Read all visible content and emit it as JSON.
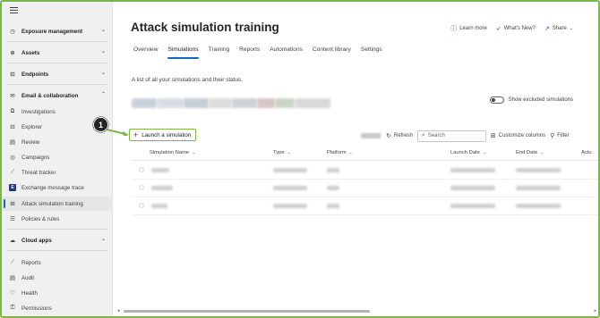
{
  "sidebar": {
    "sections": [
      {
        "label": "Exposure management",
        "icon": "clock-icon",
        "expanded": false
      },
      {
        "label": "Assets",
        "icon": "assets-icon",
        "expanded": false
      },
      {
        "label": "Endpoints",
        "icon": "endpoints-icon",
        "expanded": false
      },
      {
        "label": "Email & collaboration",
        "icon": "mail-icon",
        "expanded": true
      },
      {
        "label": "Cloud apps",
        "icon": "cloud-icon",
        "expanded": false
      }
    ],
    "email_items": [
      {
        "label": "Investigations",
        "icon": "investigation-icon"
      },
      {
        "label": "Explorer",
        "icon": "explorer-icon"
      },
      {
        "label": "Review",
        "icon": "review-icon"
      },
      {
        "label": "Campaigns",
        "icon": "campaigns-icon"
      },
      {
        "label": "Threat tracker",
        "icon": "tracker-icon"
      },
      {
        "label": "Exchange message trace",
        "icon": "exchange-icon"
      },
      {
        "label": "Attack simulation training",
        "icon": "simulation-icon",
        "active": true
      },
      {
        "label": "Policies & rules",
        "icon": "policies-icon"
      }
    ],
    "bottom_items": [
      {
        "label": "Reports",
        "icon": "reports-icon"
      },
      {
        "label": "Audit",
        "icon": "audit-icon"
      },
      {
        "label": "Health",
        "icon": "health-icon"
      },
      {
        "label": "Permissions",
        "icon": "permissions-icon"
      }
    ]
  },
  "header": {
    "title": "Attack simulation training",
    "learn_more": "Learn more",
    "whats_new": "What's New?",
    "share": "Share"
  },
  "tabs": [
    "Overview",
    "Simulations",
    "Training",
    "Reports",
    "Automations",
    "Content library",
    "Settings"
  ],
  "active_tab": "Simulations",
  "description": "A list of all your simulations and their status.",
  "toggle_label": "Show excluded simulations",
  "launch_button": "Launch a simulation",
  "callout_number": "1",
  "toolbar": {
    "refresh": "Refresh",
    "search_placeholder": "Search",
    "customize": "Customize columns",
    "filter": "Filter"
  },
  "columns": [
    "Simulation Name",
    "Type",
    "Platform",
    "Launch Date",
    "End Date",
    "Actu"
  ],
  "colors": {
    "accent": "#0f6cbd",
    "highlight": "#7ab648"
  }
}
